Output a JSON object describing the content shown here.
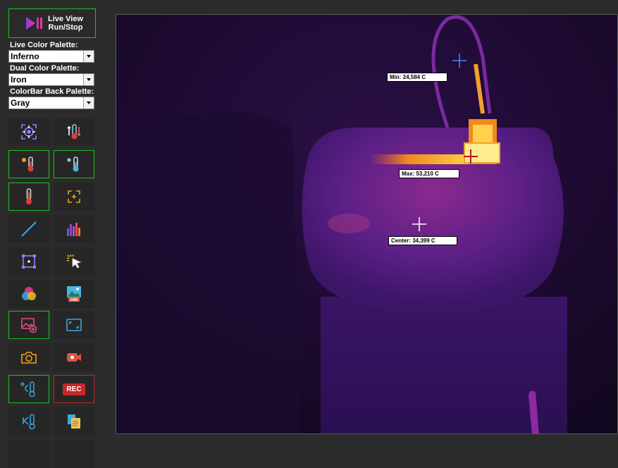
{
  "toolbar": {
    "live_view_label_line1": "Live View",
    "live_view_label_line2": "Run/Stop",
    "live_palette_label": "Live Color Palette:",
    "live_palette_value": "Inferno",
    "dual_palette_label": "Dual Color Palette:",
    "dual_palette_value": "Iron",
    "colorbar_label": "ColorBar Back Palette:",
    "colorbar_value": "Gray",
    "rec_label": "REC",
    "resolution_badge": "1080"
  },
  "icons": {
    "live": "play-pause-icon",
    "row1": [
      "target-focus-icon",
      "thermometer-swap-icon"
    ],
    "row2": [
      "thermometer-hot-icon",
      "thermometer-cold-icon"
    ],
    "row3": [
      "thermometer-icon",
      "point-select-icon"
    ],
    "row4": [
      "line-measure-icon",
      "histogram-icon"
    ],
    "row5": [
      "area-measure-icon",
      "cursor-click-icon"
    ],
    "row6": [
      "color-palette-icon",
      "gallery-icon"
    ],
    "row7": [
      "add-image-icon",
      "fullscreen-icon"
    ],
    "row8": [
      "camera-icon",
      "video-record-icon"
    ],
    "row9": [
      "celsius-thermometer-icon",
      "rec-icon"
    ],
    "row10": [
      "kelvin-thermometer-icon",
      "file-export-icon"
    ]
  },
  "readouts": {
    "min": "Min: 24,584 C",
    "max": "Max: 53,210 C",
    "center": "Center: 34,399 C"
  },
  "colors": {
    "active_border": "#1fbf1f",
    "rec_border": "#c0282a",
    "min_cross": "#3a8cff",
    "max_cross": "#c0141e",
    "center_cross": "#ffffff"
  }
}
